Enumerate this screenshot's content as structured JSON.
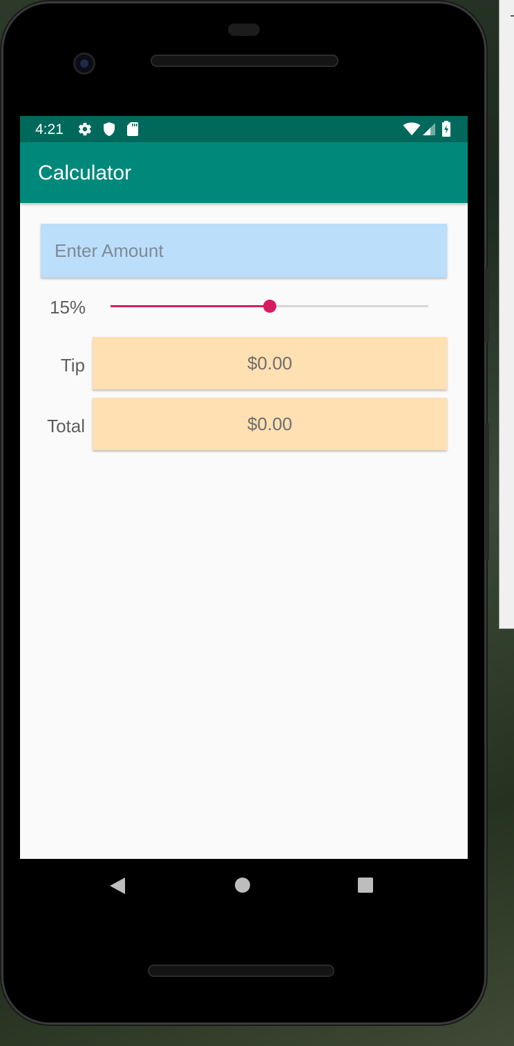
{
  "status_bar": {
    "time": "4:21",
    "icons": [
      "gear-icon",
      "shield-icon",
      "sd-card-icon",
      "wifi-icon",
      "signal-icon",
      "battery-icon"
    ]
  },
  "app_bar": {
    "title": "Calculator"
  },
  "amount_field": {
    "placeholder": "Enter Amount",
    "value": ""
  },
  "tip_slider": {
    "label": "15%",
    "value_fraction": 0.5
  },
  "tip_row": {
    "label": "Tip",
    "value": "$0.00"
  },
  "total_row": {
    "label": "Total",
    "value": "$0.00"
  },
  "nav_bar": {
    "icons": [
      "back-icon",
      "home-icon",
      "recents-icon"
    ]
  },
  "colors": {
    "status_bar": "#00695c",
    "app_bar": "#00897b",
    "accent": "#d81b60",
    "amount_field_bg": "#bbdefb",
    "result_bg": "#ffe0b2"
  }
}
